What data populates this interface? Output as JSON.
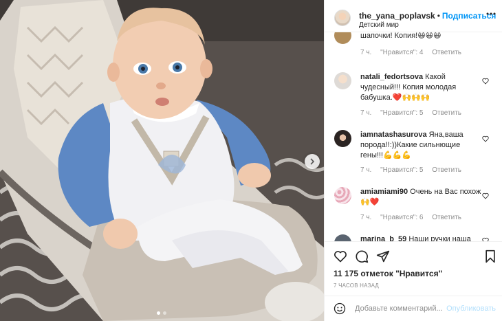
{
  "header": {
    "username": "the_yana_poplavsk",
    "separator": "•",
    "follow_label": "Подписаться",
    "location": "Детский мир"
  },
  "comments": [
    {
      "username": "",
      "text": "шапочки! Копия!😆😆😆",
      "time": "7 ч.",
      "likes": "\"Нравится\": 4",
      "reply": "Ответить",
      "avatar": "partial-avatar"
    },
    {
      "username": "natali_fedortsova",
      "text": "Какой чудесный!!! Копия молодая бабушка.❤️🙌🙌🙌",
      "time": "7 ч.",
      "likes": "\"Нравится\": 5",
      "reply": "Ответить",
      "avatar": "woman-avatar"
    },
    {
      "username": "iamnatashasurova",
      "text": "Яна,ваша порода!!:))Какие сильнющие гены!!!💪💪💪",
      "time": "7 ч.",
      "likes": "\"Нравится\": 5",
      "reply": "Ответить",
      "avatar": "dark-hair-avatar"
    },
    {
      "username": "amiamiami90",
      "text": "Очень на Вас похож🙌❤️",
      "time": "7 ч.",
      "likes": "\"Нравится\": 6",
      "reply": "Ответить",
      "avatar": "pink-pattern-avatar"
    },
    {
      "username": "marina_b_59",
      "text": "Наши ручки наша",
      "time": "",
      "likes": "",
      "reply": "",
      "avatar": "partial-avatar"
    }
  ],
  "actions": {
    "likes_text": "11 175 отметок \"Нравится\"",
    "time_ago": "7 ЧАСОВ НАЗАД"
  },
  "add_comment": {
    "placeholder": "Добавьте комментарий...",
    "publish_label": "Опубликовать"
  },
  "colors": {
    "accent_blue": "#0095f6",
    "publish_disabled": "#b2dffc",
    "secondary_text": "#8e8e8e",
    "heart_red": "#ed4956"
  },
  "carousel": {
    "slides": 2,
    "active_slide": 1
  }
}
